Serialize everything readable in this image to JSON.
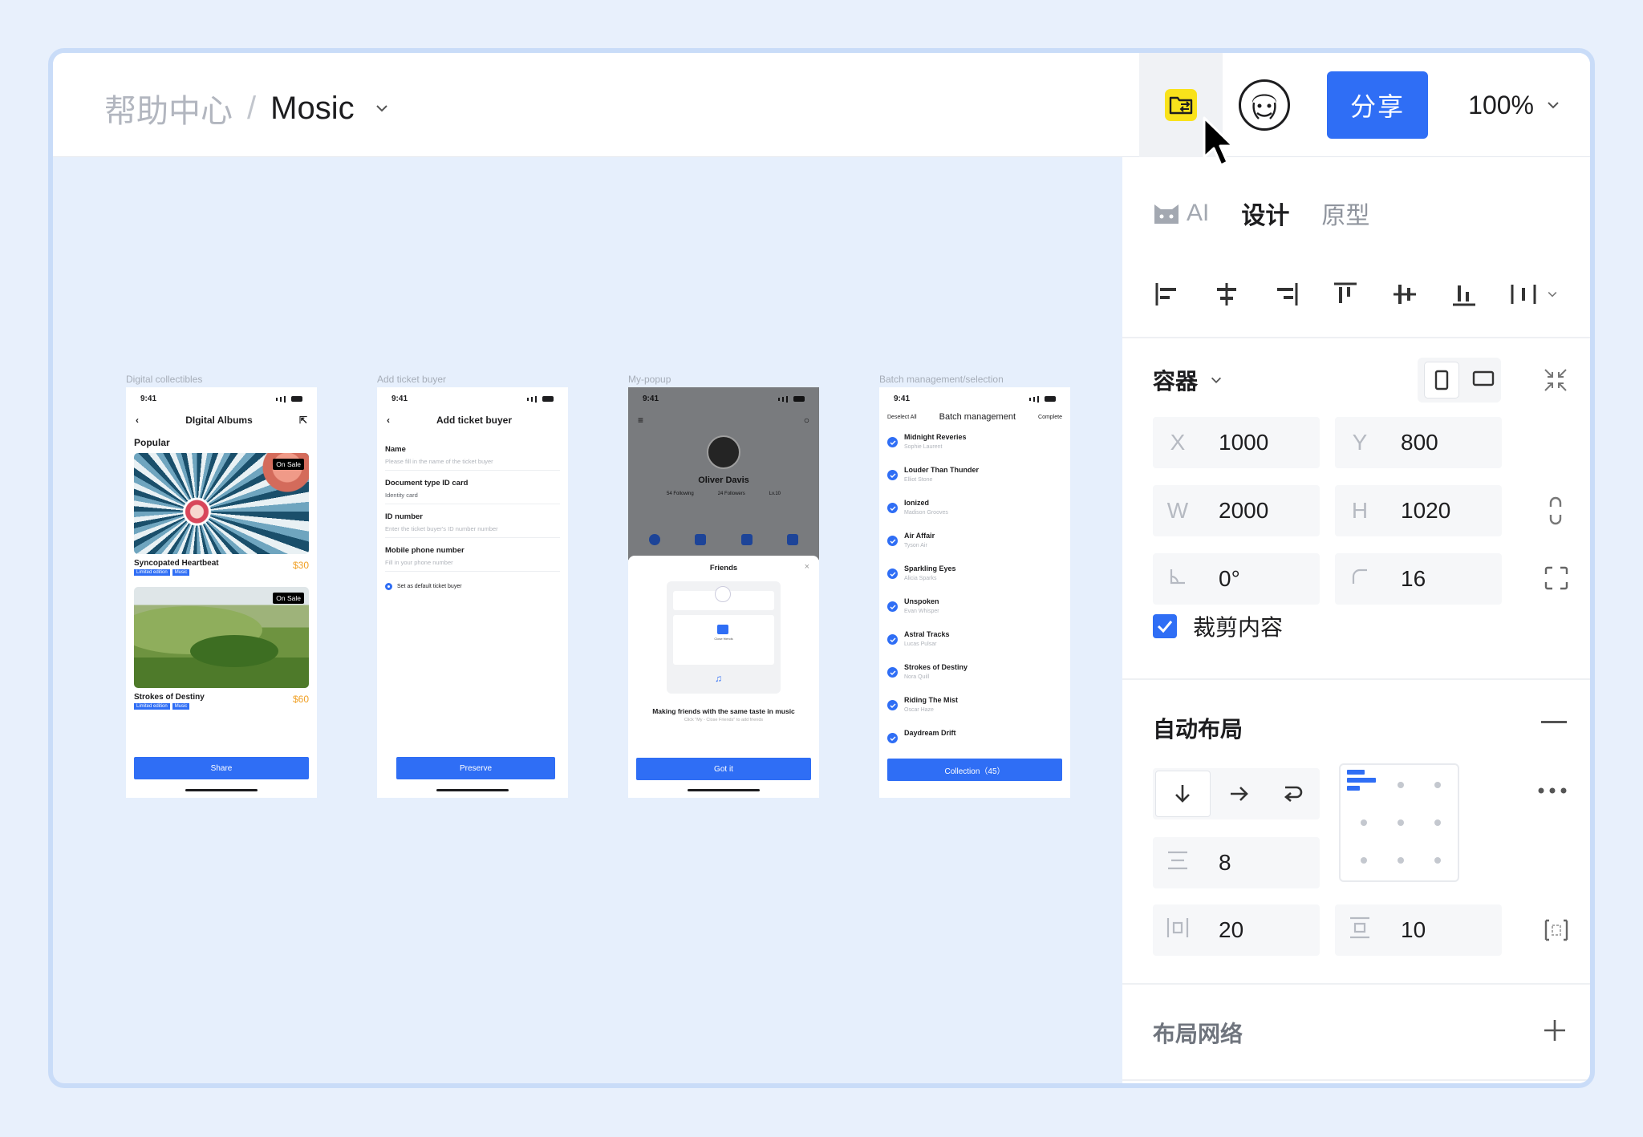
{
  "breadcrumb": {
    "root": "帮助中心",
    "separator": "/",
    "project": "Mosic"
  },
  "toolbar": {
    "share_label": "分享",
    "zoom": "100%"
  },
  "artboards": [
    {
      "label": "Digital collectibles",
      "time": "9:41",
      "title": "DIgital Albums",
      "section": "Popular",
      "albums": [
        {
          "tag": "On Sale",
          "name": "Syncopated Heartbeat",
          "chips": [
            "Limited edition",
            "Music"
          ],
          "price": "$30"
        },
        {
          "tag": "On Sale",
          "name": "Strokes of Destiny",
          "chips": [
            "Limited edition",
            "Music"
          ],
          "price": "$60"
        }
      ],
      "button": "Share"
    },
    {
      "label": "Add ticket buyer",
      "time": "9:41",
      "title": "Add ticket buyer",
      "fields": [
        {
          "label": "Name",
          "value": "Please fill in the name of the ticket buyer"
        },
        {
          "label": "Document type  ID card",
          "value": "Identity card"
        },
        {
          "label": "ID number",
          "value": "Enter the ticket buyer's ID number number"
        },
        {
          "label": "Mobile phone number",
          "value": "Fill in your phone number"
        }
      ],
      "radio": "Set as default ticket buyer",
      "button": "Preserve"
    },
    {
      "label": "My-popup",
      "time": "9:41",
      "user": "Oliver Davis",
      "stats": [
        "54 Following",
        "24 Followers",
        "Lv.10"
      ],
      "popup_title": "Friends",
      "popup_center_label": "Close friends",
      "popup_text": "Making friends with the same taste in music",
      "popup_hint": "Click \"My - Close Friends\" to add friends",
      "button": "Got it"
    },
    {
      "label": "Batch management/selection",
      "time": "9:41",
      "left_action": "Deselect All",
      "title": "Batch management",
      "right_action": "Complete",
      "items": [
        {
          "title": "Midnight Reveries",
          "artist": "Sophie Laurent"
        },
        {
          "title": "Louder Than Thunder",
          "artist": "Elliot Stone"
        },
        {
          "title": "Ionized",
          "artist": "Madison Grooves"
        },
        {
          "title": "Air Affair",
          "artist": "Tyson Air"
        },
        {
          "title": "Sparkling Eyes",
          "artist": "Alicia Sparks"
        },
        {
          "title": "Unspoken",
          "artist": "Evan Whisper"
        },
        {
          "title": "Astral Tracks",
          "artist": "Lucas Pulsar"
        },
        {
          "title": "Strokes of Destiny",
          "artist": "Nora Quill"
        },
        {
          "title": "Riding The Mist",
          "artist": "Oscar Haze"
        },
        {
          "title": "Daydream Drift",
          "artist": ""
        }
      ],
      "button": "Collection（45）"
    }
  ],
  "panel": {
    "tabs": {
      "ai": "AI",
      "design": "设计",
      "prototype": "原型"
    },
    "container": {
      "title": "容器",
      "x_label": "X",
      "x": "1000",
      "y_label": "Y",
      "y": "800",
      "w_label": "W",
      "w": "2000",
      "h_label": "H",
      "h": "1020",
      "rotation": "0°",
      "radius": "16",
      "clip_label": "裁剪内容"
    },
    "auto_layout": {
      "title": "自动布局",
      "gap": "8",
      "padding_h": "20",
      "padding_v": "10"
    },
    "layout_grid": {
      "title": "布局网络"
    }
  }
}
